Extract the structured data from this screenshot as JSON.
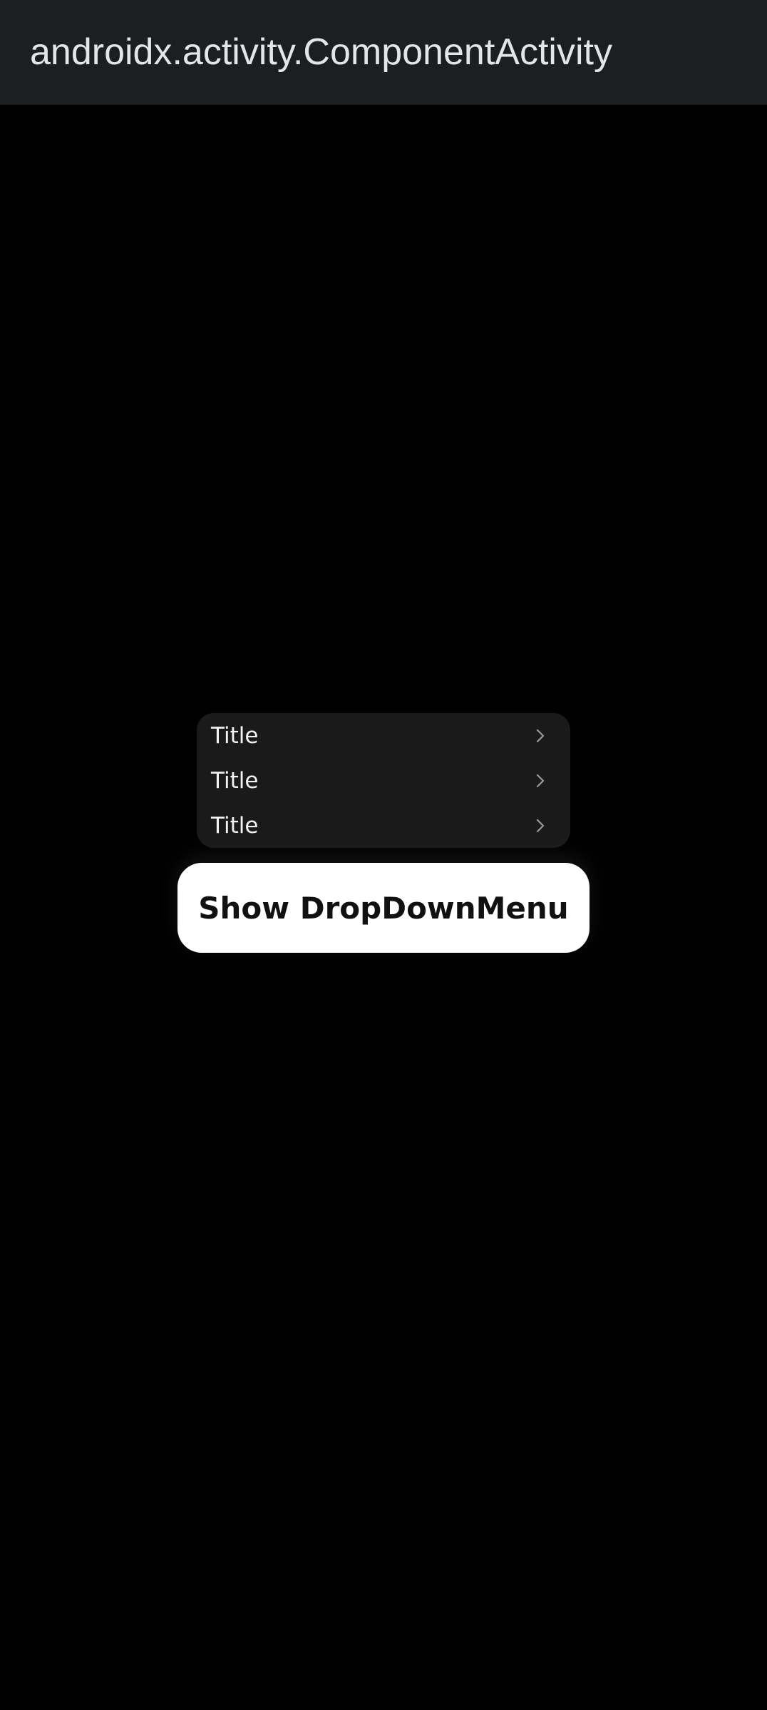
{
  "app_bar": {
    "title": "androidx.activity.ComponentActivity"
  },
  "dropdown_menu": {
    "items": [
      {
        "label": "Title",
        "icon": "chevron-right-icon"
      },
      {
        "label": "Title",
        "icon": "chevron-right-icon"
      },
      {
        "label": "Title",
        "icon": "chevron-right-icon"
      }
    ]
  },
  "show_button": {
    "label": "Show DropDownMenu"
  },
  "colors": {
    "background": "#000000",
    "app_bar": "#1c1f22",
    "menu_surface": "#1a1a1a",
    "button_surface": "#ffffff"
  }
}
